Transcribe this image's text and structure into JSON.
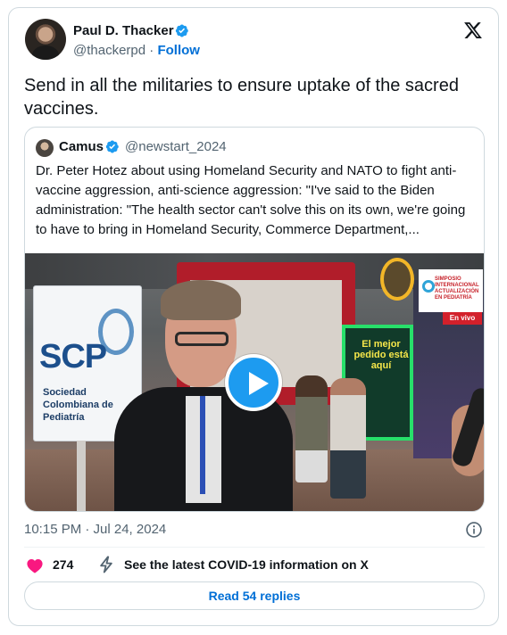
{
  "author": {
    "name": "Paul D. Thacker",
    "handle": "@thackerpd",
    "separator": "·",
    "follow_label": "Follow"
  },
  "tweet": {
    "text": "Send in all the militaries to ensure uptake of the sacred vaccines.",
    "timestamp": "10:15 PM · Jul 24, 2024",
    "likes": "274",
    "covid_link": "See the latest COVID-19 information on X",
    "replies_label": "Read 54 replies"
  },
  "quoted": {
    "name": "Camus",
    "handle": "@newstart_2024",
    "text": "Dr. Peter Hotez about using Homeland Security and NATO to fight anti-vaccine aggression, anti-science aggression: \"I've said to the Biden administration: \"The health sector can't solve this on its own, we're going to have to bring in Homeland Security, Commerce Department,..."
  },
  "video": {
    "sign_logo": "SCP",
    "sign_subtitle": "Sociedad Colombiana de Pediatría",
    "booth_text": "El mejor pedido está aquí",
    "badge_text": "SIMPOSIO INTERNACIONAL ACTUALIZACIÓN EN PEDIATRÍA",
    "live_label": "En vivo"
  },
  "icons": {
    "x_logo": "x-logo-icon",
    "verified": "verified-badge-icon",
    "play": "play-icon",
    "info": "info-icon",
    "heart": "heart-icon",
    "bolt": "bolt-icon"
  },
  "colors": {
    "accent": "#1d9bf0",
    "link": "#006fd6",
    "heart": "#f91880",
    "muted": "#536471",
    "border": "#cfd9de"
  }
}
